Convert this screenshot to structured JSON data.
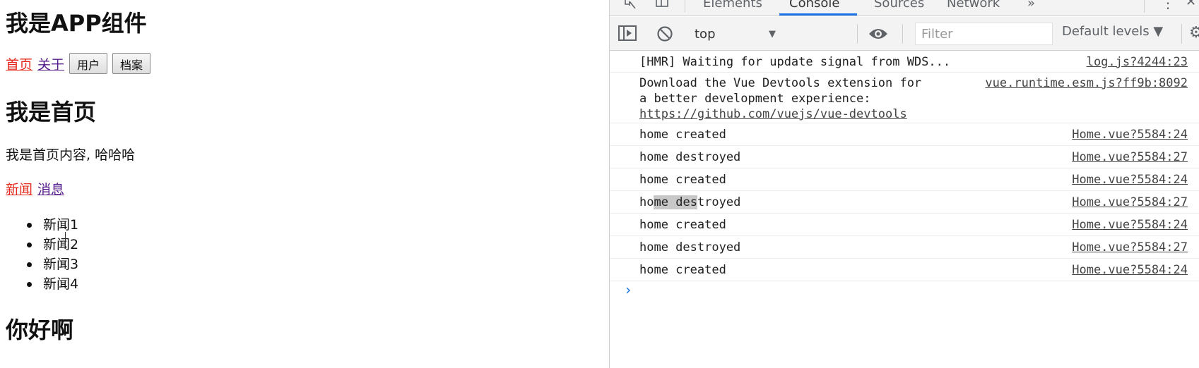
{
  "app": {
    "title": "我是APP组件",
    "nav": {
      "home": "首页",
      "about": "关于",
      "user_button": "用户",
      "profile_button": "档案"
    },
    "home": {
      "title": "我是首页",
      "content": "我是首页内容, 哈哈哈",
      "sub_nav": {
        "news": "新闻",
        "messages": "消息"
      },
      "news_items": [
        "新闻1",
        "新闻2",
        "新闻3",
        "新闻4"
      ]
    },
    "hello_title": "你好啊"
  },
  "devtools": {
    "tabs": [
      "Elements",
      "Console",
      "Sources",
      "Network"
    ],
    "active_tab": "Console",
    "more_tabs": "»",
    "context": "top",
    "filter_placeholder": "Filter",
    "levels": "Default levels ▼",
    "messages": [
      {
        "text": "[HMR] Waiting for update signal from WDS...",
        "source": "log.js?4244:23"
      },
      {
        "text_line1": "Download the Vue Devtools extension for",
        "text_line2": "a better development experience:",
        "url": "https://github.com/vuejs/vue-devtools",
        "source": "vue.runtime.esm.js?ff9b:8092"
      },
      {
        "text": "home created",
        "source": "Home.vue?5584:24"
      },
      {
        "text": "home destroyed",
        "source": "Home.vue?5584:27"
      },
      {
        "text": "home created",
        "source": "Home.vue?5584:24"
      },
      {
        "text_pre": "ho",
        "text_hl1": "me",
        "text_mid": " ",
        "text_hl2": "des",
        "text_post": "troyed",
        "source": "Home.vue?5584:27"
      },
      {
        "text": "home created",
        "source": "Home.vue?5584:24"
      },
      {
        "text": "home destroyed",
        "source": "Home.vue?5584:27"
      },
      {
        "text": "home created",
        "source": "Home.vue?5584:24"
      }
    ],
    "prompt": "›",
    "colors": {
      "accent": "#1a73e8",
      "link_active": "#e4291c",
      "link_visited": "#551a8b"
    }
  }
}
